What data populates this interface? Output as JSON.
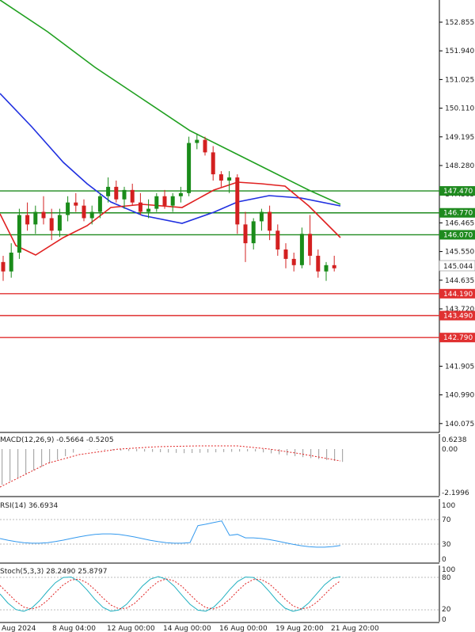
{
  "price_chart": {
    "y_ticks": [
      "152.855",
      "151.940",
      "151.025",
      "150.110",
      "149.195",
      "148.280",
      "147.365",
      "146.465",
      "145.550",
      "144.635",
      "143.720",
      "142.805",
      "141.905",
      "140.990",
      "140.075"
    ],
    "current_price": "145.044",
    "levels": [
      {
        "label": "147.470",
        "color": "#1f8a1f"
      },
      {
        "label": "146.770",
        "color": "#1f8a1f"
      },
      {
        "label": "146.070",
        "color": "#1f8a1f"
      },
      {
        "label": "144.190",
        "color": "#e03030"
      },
      {
        "label": "143.490",
        "color": "#e03030"
      },
      {
        "label": "142.790",
        "color": "#e03030"
      }
    ],
    "x_ticks": [
      "Aug 2024",
      "8 Aug 04:00",
      "12 Aug 00:00",
      "14 Aug 00:00",
      "16 Aug 00:00",
      "19 Aug 20:00",
      "21 Aug 20:00"
    ],
    "colors": {
      "up": "#1a8c1a",
      "down": "#d32020",
      "ma_fast": "#e02020",
      "ma_mid": "#2030e0",
      "ma_slow": "#20a020"
    }
  },
  "macd": {
    "label": "MACD(12,26,9) -0.5664 -0.5205",
    "ticks": [
      "0.6238",
      "0.00",
      "-2.1996"
    ]
  },
  "rsi": {
    "label": "RSI(14) 36.6934",
    "ticks": [
      "100",
      "70",
      "30",
      "0"
    ]
  },
  "stoch": {
    "label": "Stoch(5,3,3) 28.2490 25.8797",
    "ticks": [
      "100",
      "80",
      "20",
      "0"
    ]
  },
  "chart_data": {
    "type": "candlestick",
    "series": [
      {
        "values": [
          [
            145.2,
            145.4,
            144.6,
            144.9
          ],
          [
            144.9,
            145.8,
            144.7,
            145.5
          ],
          [
            145.5,
            146.9,
            145.3,
            146.7
          ],
          [
            146.7,
            147.1,
            146.2,
            146.4
          ],
          [
            146.4,
            147.0,
            146.1,
            146.8
          ],
          [
            146.8,
            147.3,
            146.4,
            146.6
          ],
          [
            146.6,
            146.9,
            145.9,
            146.2
          ],
          [
            146.2,
            146.9,
            146.0,
            146.7
          ],
          [
            146.7,
            147.3,
            146.5,
            147.1
          ],
          [
            147.1,
            147.4,
            146.8,
            147.0
          ],
          [
            147.0,
            147.2,
            146.5,
            146.6
          ],
          [
            146.6,
            147.0,
            146.4,
            146.8
          ],
          [
            146.8,
            147.4,
            146.6,
            147.3
          ],
          [
            147.3,
            147.9,
            147.1,
            147.6
          ],
          [
            147.6,
            147.8,
            147.1,
            147.2
          ],
          [
            147.2,
            147.6,
            146.9,
            147.5
          ],
          [
            147.5,
            147.7,
            147.0,
            147.1
          ],
          [
            147.1,
            147.4,
            146.7,
            146.8
          ],
          [
            146.8,
            147.2,
            146.6,
            146.9
          ],
          [
            146.9,
            147.4,
            146.8,
            147.3
          ],
          [
            147.3,
            147.5,
            146.9,
            147.0
          ],
          [
            147.0,
            147.4,
            146.8,
            147.3
          ],
          [
            147.3,
            147.6,
            147.1,
            147.4
          ],
          [
            147.4,
            149.2,
            147.3,
            149.0
          ],
          [
            149.0,
            149.3,
            148.8,
            149.1
          ],
          [
            149.1,
            149.2,
            148.6,
            148.7
          ],
          [
            148.7,
            148.9,
            147.8,
            148.0
          ],
          [
            148.0,
            148.1,
            147.6,
            147.8
          ],
          [
            147.8,
            148.1,
            147.4,
            147.9
          ],
          [
            147.9,
            148.0,
            146.1,
            146.4
          ],
          [
            146.4,
            146.8,
            145.2,
            145.8
          ],
          [
            145.8,
            146.6,
            145.6,
            146.5
          ],
          [
            146.5,
            146.9,
            146.2,
            146.8
          ],
          [
            146.8,
            147.0,
            145.9,
            146.2
          ],
          [
            146.2,
            146.4,
            145.4,
            145.6
          ],
          [
            145.6,
            145.8,
            145.0,
            145.3
          ],
          [
            145.3,
            145.5,
            144.9,
            145.1
          ],
          [
            145.1,
            146.3,
            145.0,
            146.1
          ],
          [
            146.1,
            146.7,
            145.1,
            145.4
          ],
          [
            145.4,
            145.6,
            144.7,
            144.9
          ],
          [
            144.9,
            145.2,
            144.6,
            145.1
          ],
          [
            145.1,
            145.4,
            144.9,
            145.0
          ]
        ]
      }
    ]
  }
}
